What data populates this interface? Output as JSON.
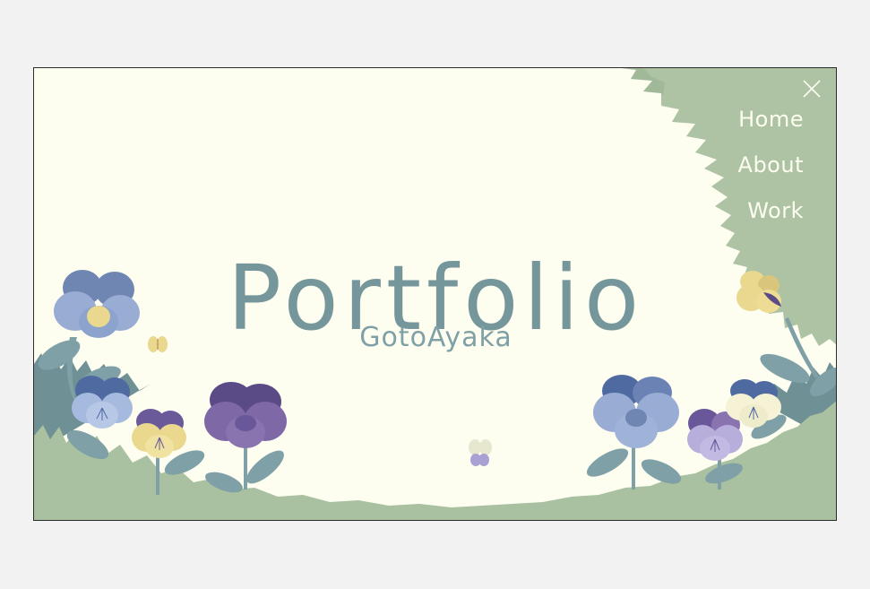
{
  "hero": {
    "title": "Portfolio",
    "subtitle": "GotoAyaka"
  },
  "nav": {
    "close_icon": "close-icon",
    "items": [
      {
        "label": "Home"
      },
      {
        "label": "About"
      },
      {
        "label": "Work"
      }
    ]
  },
  "colors": {
    "background": "#fdfdf0",
    "title": "#75979c",
    "menu_panel": "#adc3a4",
    "menu_text": "#fdfdf0",
    "grass": "#a9c1a0",
    "grass_dark": "#6f9095"
  }
}
